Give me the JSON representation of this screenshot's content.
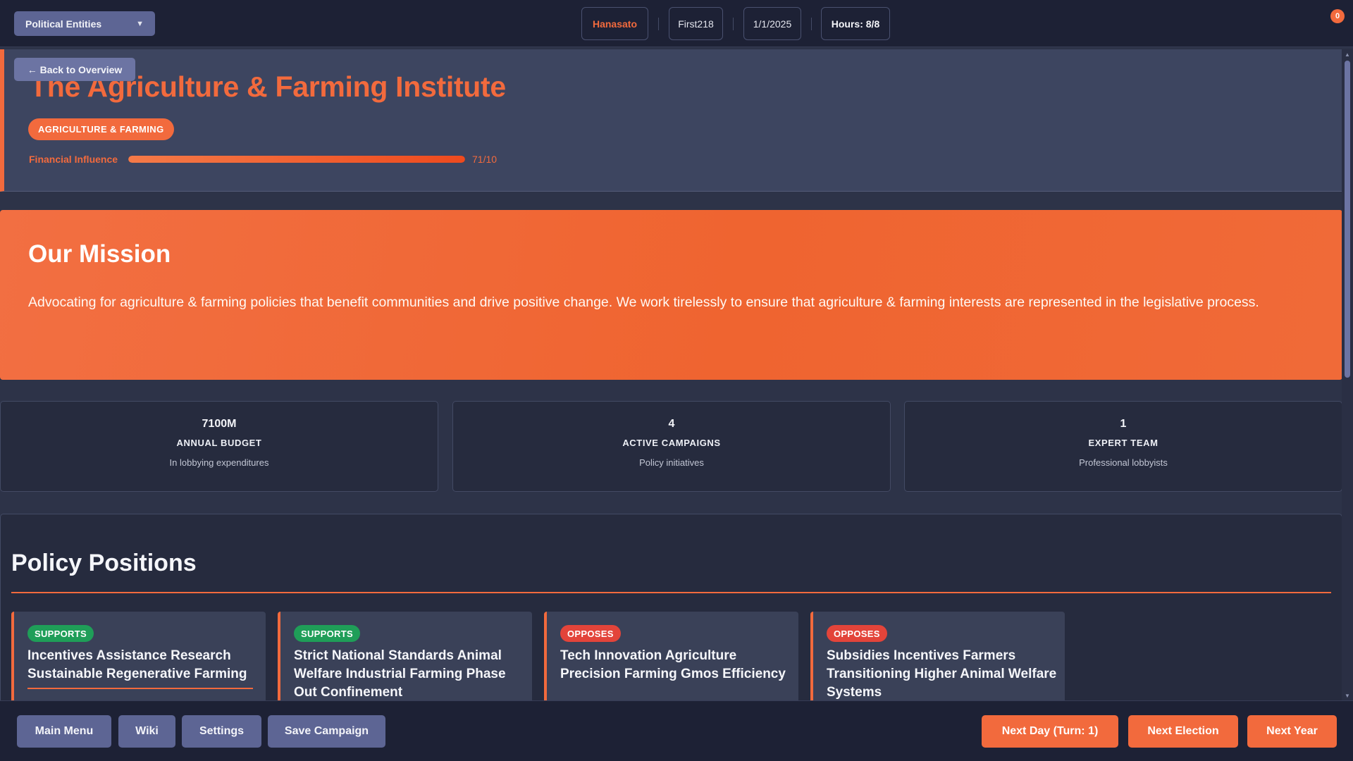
{
  "topbar": {
    "entity_select": "Political Entities",
    "player": "Hanasato",
    "party": "First218",
    "date": "1/1/2025",
    "hours": "Hours: 8/8",
    "notification_count": "0"
  },
  "header": {
    "back_label": "← Back to Overview",
    "title": "The Agriculture & Farming Institute",
    "category": "AGRICULTURE & FARMING",
    "influence_label": "Financial Influence",
    "influence_value": "71/10",
    "influence_fill_fraction": 1.0
  },
  "mission": {
    "heading": "Our Mission",
    "text": "Advocating for agriculture & farming policies that benefit communities and drive positive change. We work tirelessly to ensure that agriculture & farming interests are represented in the legislative process."
  },
  "stats": [
    {
      "value": "7100M",
      "label": "ANNUAL BUDGET",
      "sub": "In lobbying expenditures"
    },
    {
      "value": "4",
      "label": "ACTIVE CAMPAIGNS",
      "sub": "Policy initiatives"
    },
    {
      "value": "1",
      "label": "EXPERT TEAM",
      "sub": "Professional lobbyists"
    }
  ],
  "policies": {
    "heading": "Policy Positions",
    "items": [
      {
        "stance": "SUPPORTS",
        "title": "Incentives Assistance Research Sustainable Regenerative Farming"
      },
      {
        "stance": "SUPPORTS",
        "title": "Strict National Standards Animal Welfare Industrial Farming Phase Out Confinement"
      },
      {
        "stance": "OPPOSES",
        "title": "Tech Innovation Agriculture Precision Farming Gmos Efficiency"
      },
      {
        "stance": "OPPOSES",
        "title": "Subsidies Incentives Farmers Transitioning Higher Animal Welfare Systems"
      }
    ]
  },
  "bottombar": {
    "main_menu": "Main Menu",
    "wiki": "Wiki",
    "settings": "Settings",
    "save_campaign": "Save Campaign",
    "next_day": "Next Day (Turn: 1)",
    "next_election": "Next Election",
    "next_year": "Next Year"
  },
  "colors": {
    "accent": "#f26a3d",
    "supports": "#1f9e58",
    "opposes": "#e3443a",
    "background": "#2d3348"
  }
}
